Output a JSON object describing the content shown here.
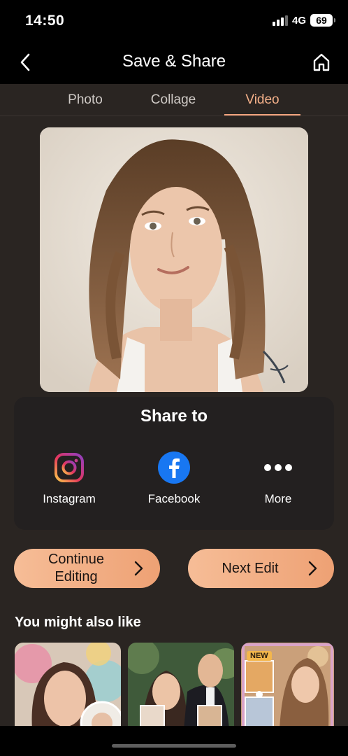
{
  "status_bar": {
    "time": "14:50",
    "network": "4G",
    "battery": "69"
  },
  "header": {
    "title": "Save & Share",
    "back_icon": "chevron-left-icon",
    "home_icon": "home-icon"
  },
  "tabs": [
    {
      "label": "Photo",
      "active": false
    },
    {
      "label": "Collage",
      "active": false
    },
    {
      "label": "Video",
      "active": true
    }
  ],
  "share": {
    "title": "Share to",
    "items": [
      {
        "label": "Instagram",
        "icon": "instagram-icon"
      },
      {
        "label": "Facebook",
        "icon": "facebook-icon"
      },
      {
        "label": "More",
        "icon": "more-dots-icon"
      }
    ]
  },
  "actions": {
    "continue_line1": "Continue",
    "continue_line2": "Editing",
    "next_edit": "Next Edit"
  },
  "suggestions": {
    "title": "You might also like",
    "badge": "NEW"
  },
  "colors": {
    "accent": "#f3a57f",
    "background": "#2a2522",
    "card": "#232020"
  }
}
